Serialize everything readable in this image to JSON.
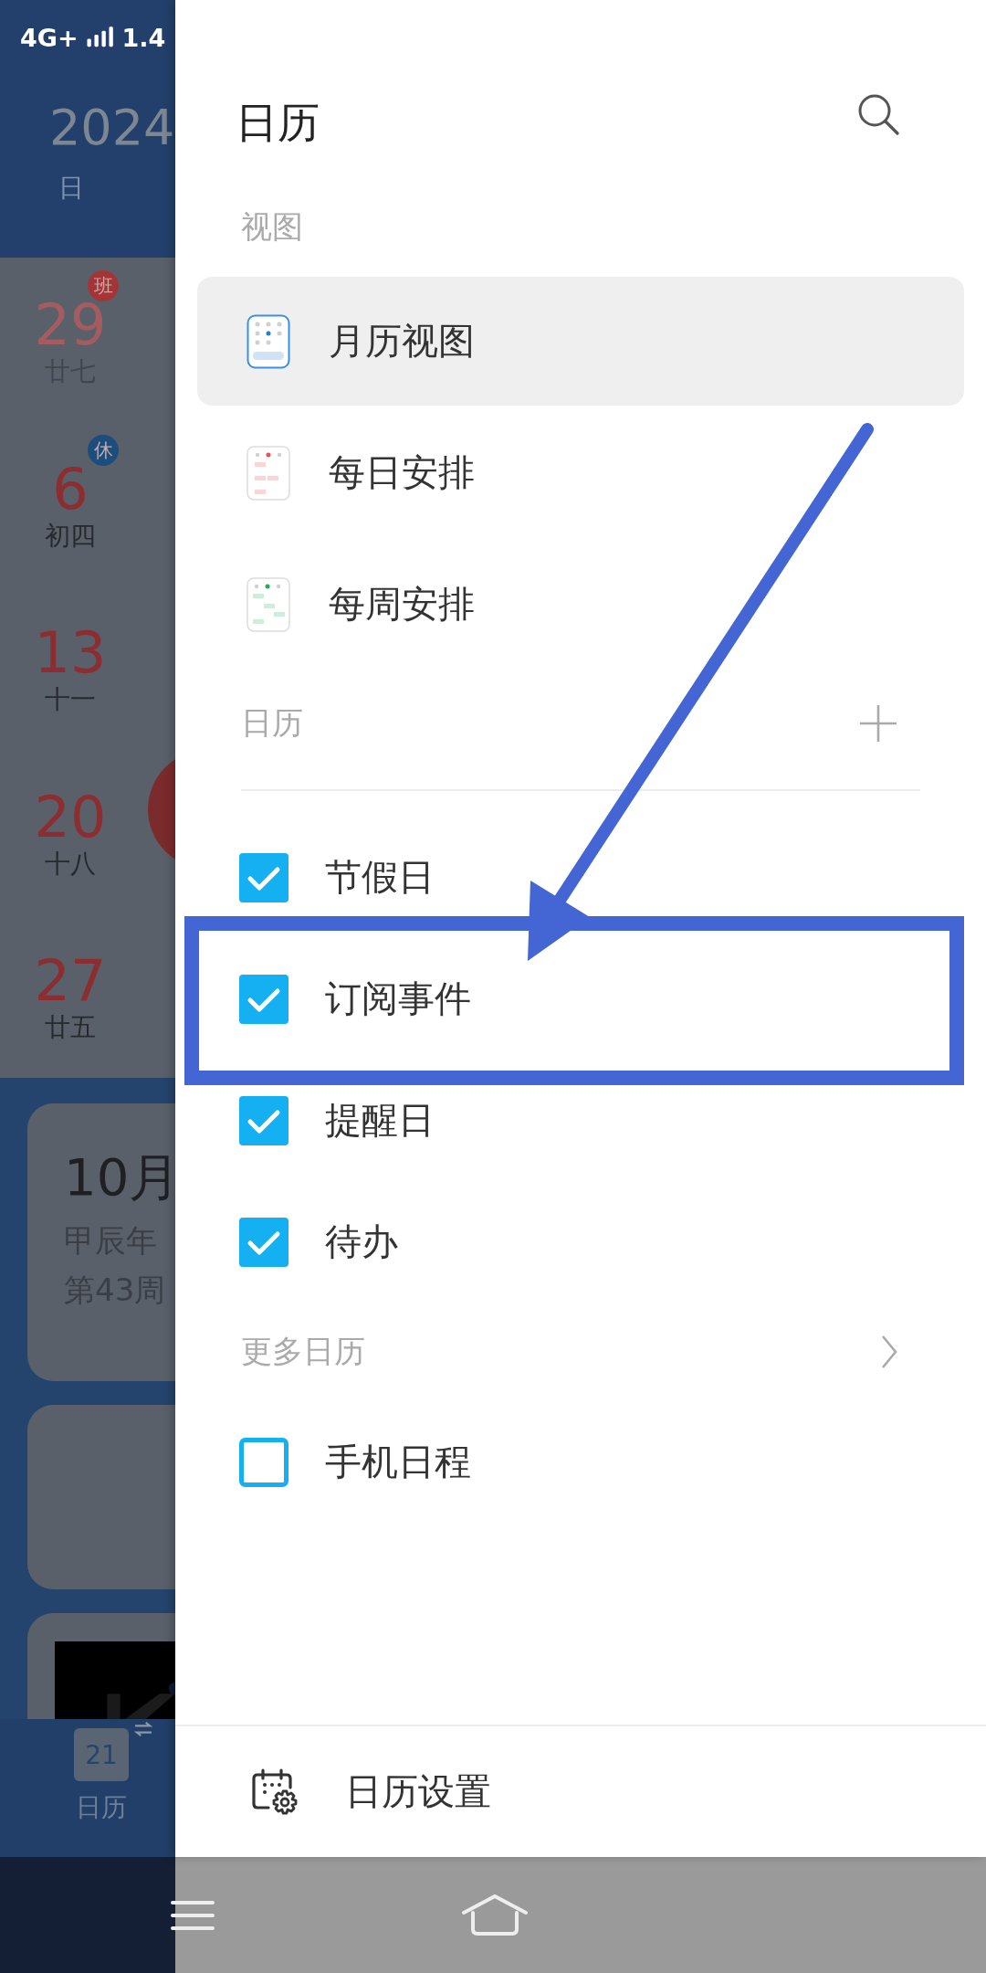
{
  "status_bar": {
    "network": "4G+",
    "speed": "1.4"
  },
  "background_calendar": {
    "year": "2024",
    "weekday": "日",
    "days": [
      {
        "date": "29",
        "lunar": "廿七",
        "faded": true,
        "badge": {
          "text": "班",
          "color": "#a33536"
        },
        "today_marker": false
      },
      {
        "date": "6",
        "lunar": "初四",
        "faded": false,
        "badge": {
          "text": "休",
          "color": "#1d4d7d"
        },
        "today_marker": false
      },
      {
        "date": "13",
        "lunar": "十一",
        "faded": false,
        "today_marker": false
      },
      {
        "date": "20",
        "lunar": "十八",
        "faded": false,
        "today_marker": true
      },
      {
        "date": "27",
        "lunar": "廿五",
        "faded": false,
        "today_marker": false
      }
    ],
    "cards": [
      {
        "kind": "date",
        "date": "10月",
        "lunar_year": "甲辰年",
        "week": "第43周"
      },
      {
        "kind": "empty"
      },
      {
        "kind": "picture"
      }
    ],
    "tab": {
      "icon_day": "21",
      "label": "日历"
    }
  },
  "drawer": {
    "title": "日历",
    "views_header": "视图",
    "views": [
      {
        "label": "月历视图",
        "kind": "month",
        "selected": true
      },
      {
        "label": "每日安排",
        "kind": "day",
        "selected": false
      },
      {
        "label": "每周安排",
        "kind": "week",
        "selected": false
      }
    ],
    "calendars_header": "日历",
    "calendars": [
      {
        "label": "节假日",
        "checked": true,
        "highlighted": false
      },
      {
        "label": "订阅事件",
        "checked": true,
        "highlighted": true
      },
      {
        "label": "提醒日",
        "checked": true,
        "highlighted": false
      },
      {
        "label": "待办",
        "checked": true,
        "highlighted": false
      }
    ],
    "more_header": "更多日历",
    "more_calendars": [
      {
        "label": "手机日程",
        "checked": false,
        "highlighted": false
      }
    ],
    "settings": "日历设置"
  }
}
